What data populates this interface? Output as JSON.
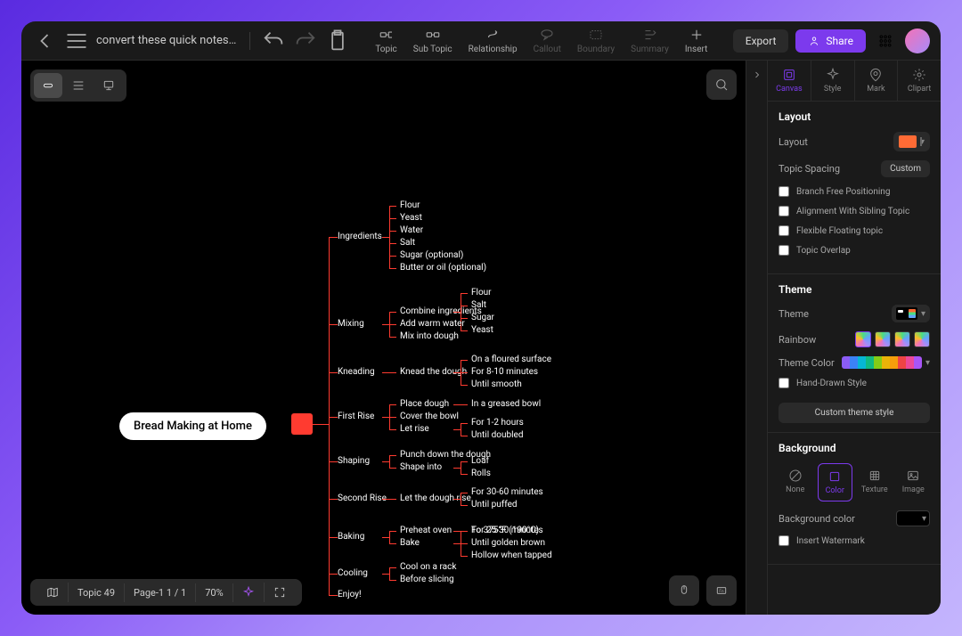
{
  "window": {
    "title": "convert these quick notes ..."
  },
  "toolbar": {
    "tools": [
      {
        "id": "topic",
        "label": "Topic",
        "enabled": true
      },
      {
        "id": "subtopic",
        "label": "Sub Topic",
        "enabled": true
      },
      {
        "id": "relationship",
        "label": "Relationship",
        "enabled": true
      },
      {
        "id": "callout",
        "label": "Callout",
        "enabled": false
      },
      {
        "id": "boundary",
        "label": "Boundary",
        "enabled": false
      },
      {
        "id": "summary",
        "label": "Summary",
        "enabled": false
      },
      {
        "id": "insert",
        "label": "Insert",
        "enabled": true
      }
    ],
    "export_label": "Export",
    "share_label": "Share"
  },
  "mindmap": {
    "root": "Bread Making at Home",
    "branches": [
      {
        "label": "Ingredients",
        "children": [
          {
            "label": "Flour"
          },
          {
            "label": "Yeast"
          },
          {
            "label": "Water"
          },
          {
            "label": "Salt"
          },
          {
            "label": "Sugar (optional)"
          },
          {
            "label": "Butter or oil (optional)"
          }
        ]
      },
      {
        "label": "Mixing",
        "children": [
          {
            "label": "Combine ingredients",
            "children": [
              {
                "label": "Flour"
              },
              {
                "label": "Salt"
              },
              {
                "label": "Sugar"
              },
              {
                "label": "Yeast"
              }
            ]
          },
          {
            "label": "Add warm water"
          },
          {
            "label": "Mix into dough"
          }
        ]
      },
      {
        "label": "Kneading",
        "children": [
          {
            "label": "Knead the dough",
            "children": [
              {
                "label": "On a floured surface"
              },
              {
                "label": "For 8-10 minutes"
              },
              {
                "label": "Until smooth"
              }
            ]
          }
        ]
      },
      {
        "label": "First Rise",
        "children": [
          {
            "label": "Place dough",
            "children": [
              {
                "label": "In a greased bowl"
              }
            ]
          },
          {
            "label": "Cover the bowl"
          },
          {
            "label": "Let rise",
            "children": [
              {
                "label": "For 1-2 hours"
              },
              {
                "label": "Until doubled"
              }
            ]
          }
        ]
      },
      {
        "label": "Shaping",
        "children": [
          {
            "label": "Punch down the dough"
          },
          {
            "label": "Shape into",
            "children": [
              {
                "label": "Loaf"
              },
              {
                "label": "Rolls"
              }
            ]
          }
        ]
      },
      {
        "label": "Second Rise",
        "children": [
          {
            "label": "Let the dough rise",
            "children": [
              {
                "label": "For 30-60 minutes"
              },
              {
                "label": "Until puffed"
              }
            ]
          }
        ]
      },
      {
        "label": "Baking",
        "children": [
          {
            "label": "Preheat oven",
            "children": [
              {
                "label": "To 375°F (190°C)"
              }
            ]
          },
          {
            "label": "Bake",
            "children": [
              {
                "label": "For 25-30 minutes"
              },
              {
                "label": "Until golden brown"
              },
              {
                "label": "Hollow when tapped"
              }
            ]
          }
        ]
      },
      {
        "label": "Cooling",
        "children": [
          {
            "label": "Cool on a rack"
          },
          {
            "label": "Before slicing"
          }
        ]
      },
      {
        "label": "Enjoy!"
      }
    ]
  },
  "statusbar": {
    "topic_count": "Topic 49",
    "page": "Page-1  1 / 1",
    "zoom": "70%"
  },
  "panel": {
    "tabs": [
      {
        "id": "canvas",
        "label": "Canvas",
        "active": true
      },
      {
        "id": "style",
        "label": "Style"
      },
      {
        "id": "mark",
        "label": "Mark"
      },
      {
        "id": "clipart",
        "label": "Clipart"
      }
    ],
    "layout": {
      "title": "Layout",
      "layout_label": "Layout",
      "spacing_label": "Topic Spacing",
      "spacing_btn": "Custom",
      "checks": [
        "Branch Free Positioning",
        "Alignment With Sibling Topic",
        "Flexible Floating topic",
        "Topic Overlap"
      ]
    },
    "theme": {
      "title": "Theme",
      "theme_label": "Theme",
      "rainbow_label": "Rainbow",
      "color_label": "Theme Color",
      "colors": [
        "#8b5cf6",
        "#3b82f6",
        "#06b6d4",
        "#10b981",
        "#84cc16",
        "#eab308",
        "#f59e0b",
        "#ef4444",
        "#ec4899",
        "#a855f7"
      ],
      "handdrawn_label": "Hand-Drawn Style",
      "custom_btn": "Custom theme style"
    },
    "background": {
      "title": "Background",
      "options": [
        {
          "id": "none",
          "label": "None"
        },
        {
          "id": "color",
          "label": "Color",
          "active": true
        },
        {
          "id": "texture",
          "label": "Texture"
        },
        {
          "id": "image",
          "label": "Image"
        }
      ],
      "bgcolor_label": "Background color",
      "bgcolor": "#000000",
      "watermark_label": "Insert Watermark"
    }
  }
}
